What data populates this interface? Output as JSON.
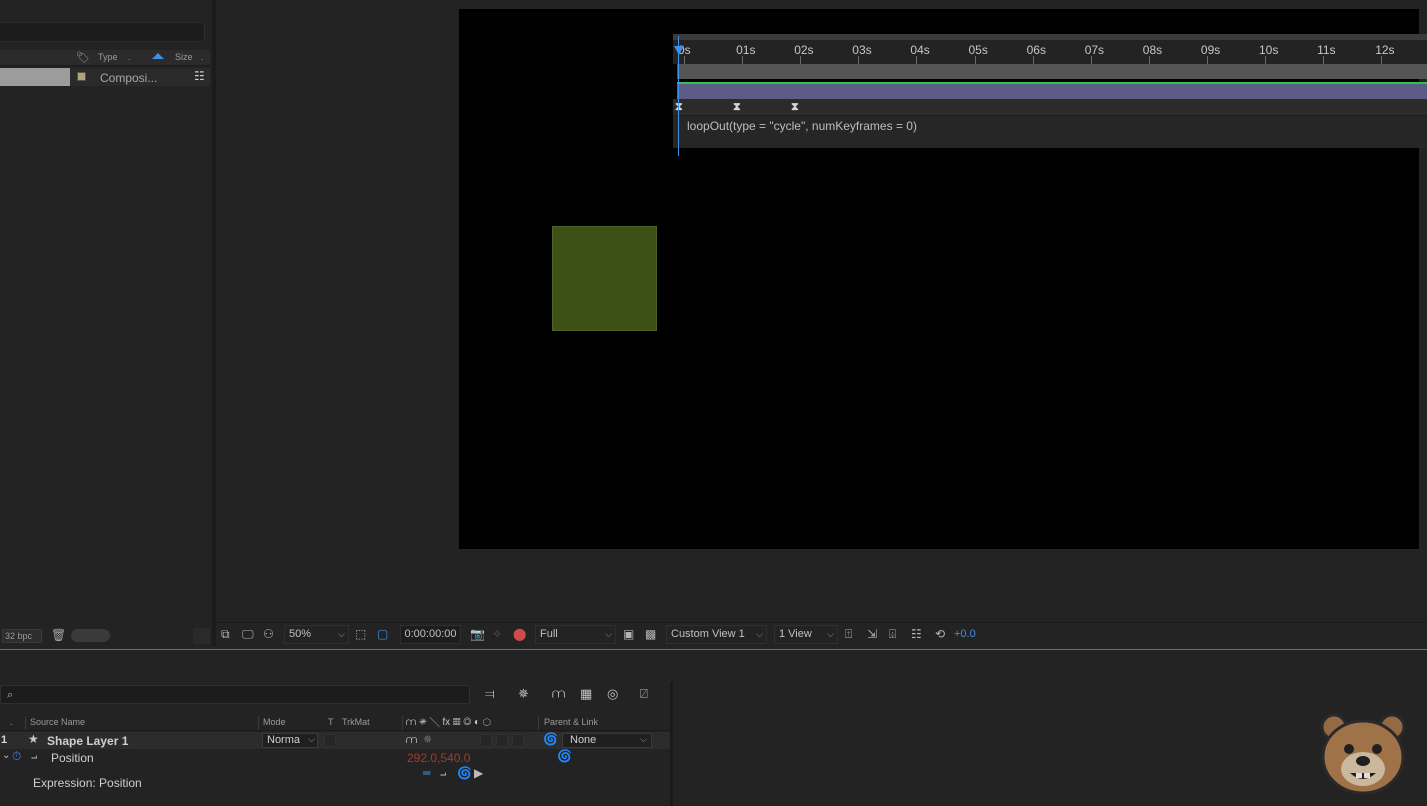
{
  "project": {
    "columns": {
      "type": "Type",
      "size": "Size"
    },
    "item": {
      "type_text": "Composi..."
    },
    "footer": {
      "bpc": "32 bpc"
    }
  },
  "viewer": {
    "zoom": "50%",
    "timecode": "0:00:00:00",
    "resolution": "Full",
    "view": "Custom View 1",
    "layout": "1 View",
    "exposure": "+0.0",
    "shape_color": "#3d5117"
  },
  "timeline": {
    "columns": {
      "source_name": "Source Name",
      "mode": "Mode",
      "t": "T",
      "trkmat": "TrkMat",
      "parent": "Parent & Link"
    },
    "layer": {
      "number": "1",
      "name": "Shape Layer 1",
      "mode": "Norma",
      "parent": "None"
    },
    "property": {
      "name": "Position",
      "value": "292.0,540.0"
    },
    "expression_label": "Expression: Position",
    "expression_text": "loopOut(type = \"cycle\", numKeyframes = 0)",
    "ruler": [
      "0s",
      "01s",
      "02s",
      "03s",
      "04s",
      "05s",
      "06s",
      "07s",
      "08s",
      "09s",
      "10s",
      "11s",
      "12s"
    ],
    "accent": "#3f8ee8",
    "layer_bar_color": "#5c5c86"
  }
}
